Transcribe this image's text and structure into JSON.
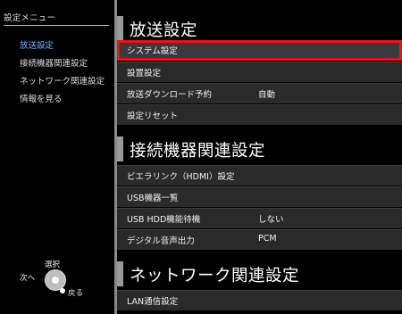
{
  "sidebar": {
    "title": "設定メニュー",
    "items": [
      {
        "label": "放送設定",
        "active": true
      },
      {
        "label": "接続機器関連設定",
        "active": false
      },
      {
        "label": "ネットワーク関連設定",
        "active": false
      },
      {
        "label": "情報を見る",
        "active": false
      }
    ]
  },
  "legend": {
    "select": "選択",
    "next": "次へ",
    "back": "戻る",
    "dial_icon": "cross-key-dial-icon"
  },
  "sections": [
    {
      "title": "放送設定",
      "rows": [
        {
          "label": "システム設定",
          "value": "",
          "focused": true
        },
        {
          "label": "設置設定",
          "value": ""
        },
        {
          "label": "放送ダウンロード予約",
          "value": "自動"
        },
        {
          "label": "設定リセット",
          "value": ""
        }
      ]
    },
    {
      "title": "接続機器関連設定",
      "rows": [
        {
          "label": "ビエラリンク（HDMI）設定",
          "value": ""
        },
        {
          "label": "USB機器一覧",
          "value": ""
        },
        {
          "label": "USB HDD機能待機",
          "value": "しない"
        },
        {
          "label": "デジタル音声出力",
          "value": "PCM"
        }
      ]
    },
    {
      "title": "ネットワーク関連設定",
      "rows": [
        {
          "label": "LAN通信設定",
          "value": ""
        }
      ]
    }
  ],
  "colors": {
    "focus_border": "#e8121b",
    "active_sidebar": "#6db3ff",
    "row_bg": "#2a2a2a"
  }
}
